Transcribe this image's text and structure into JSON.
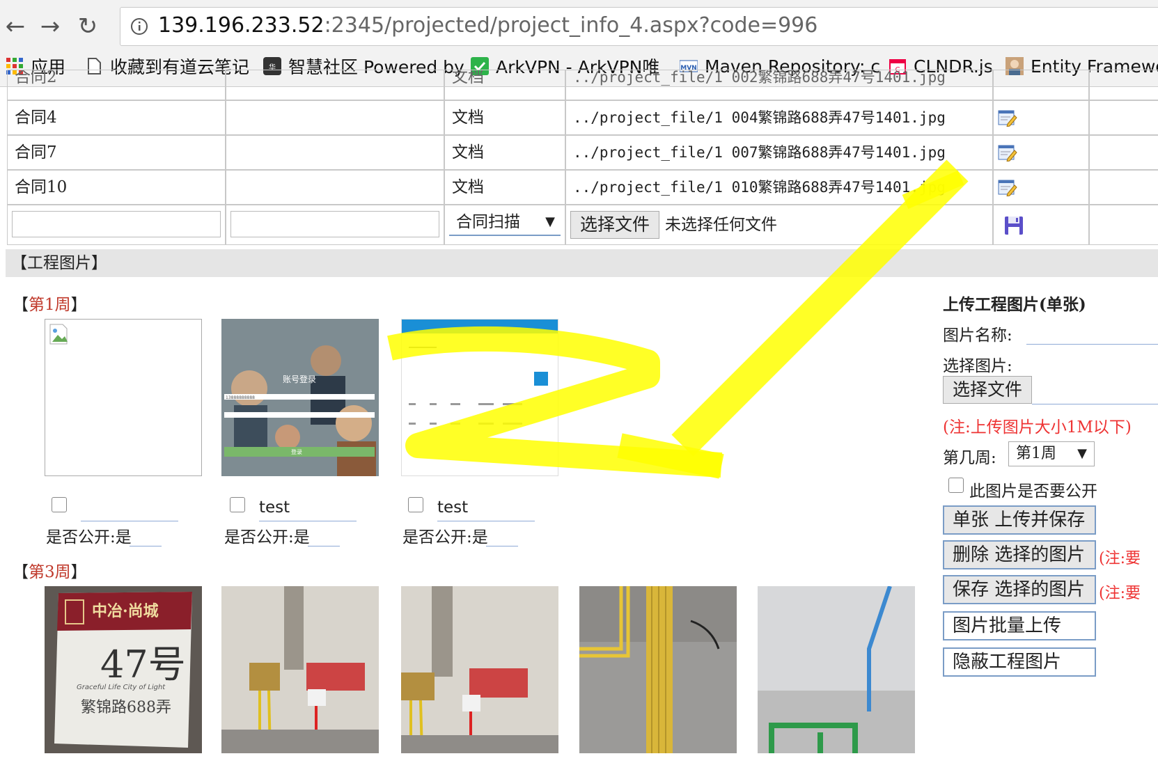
{
  "browser": {
    "url_host": "139.196.233.52",
    "url_path": ":2345/projected/project_info_4.aspx?code=996",
    "bookmarks": [
      {
        "label": "应用",
        "icon": "apps-grid-icon"
      },
      {
        "label": "收藏到有道云笔记",
        "icon": "page-icon"
      },
      {
        "label": "智慧社区 Powered by",
        "icon": "huayuan-logo-icon"
      },
      {
        "label": "ArkVPN - ArkVPN唯",
        "icon": "green-check-icon"
      },
      {
        "label": "Maven Repository: c",
        "icon": "mvn-icon"
      },
      {
        "label": "CLNDR.js",
        "icon": "calendar-icon"
      },
      {
        "label": "Entity Framewo",
        "icon": "avatar-icon"
      }
    ]
  },
  "file_table": {
    "partial_row": {
      "name": "合同2",
      "type": "文档",
      "path": "../project_file/1 002繁锦路688弄47号1401.jpg"
    },
    "rows": [
      {
        "name": "合同4",
        "note": "",
        "type": "文档",
        "path": "../project_file/1 004繁锦路688弄47号1401.jpg"
      },
      {
        "name": "合同7",
        "note": "",
        "type": "文档",
        "path": "../project_file/1 007繁锦路688弄47号1401.jpg"
      },
      {
        "name": "合同10",
        "note": "",
        "type": "文档",
        "path": "../project_file/1 010繁锦路688弄47号1401.jpg"
      }
    ],
    "new_row": {
      "type_select": "合同扫描",
      "choose_file": "选择文件",
      "no_file": "未选择任何文件"
    }
  },
  "photos_section": {
    "title": "【工程图片】",
    "week1": {
      "label_open": "【",
      "label_week": "第1周",
      "label_close": "】",
      "items": [
        {
          "name": "",
          "public": "是否公开:是"
        },
        {
          "name": "test",
          "public": "是否公开:是"
        },
        {
          "name": "test",
          "public": "是否公开:是"
        }
      ],
      "login_screenshot": {
        "title": "账号登录",
        "phone": "13888888888",
        "login_btn": "登录"
      }
    },
    "week3": {
      "label_open": "【",
      "label_week": "第3周",
      "label_close": "】",
      "sign": {
        "brand": "中冶·尚城",
        "number": "47号",
        "subtitle": "Graceful Life City of Light",
        "street": "繁锦路688弄"
      }
    }
  },
  "upload_panel": {
    "title": "上传工程图片(单张)",
    "name_label": "图片名称:",
    "select_label": "选择图片:",
    "choose_file": "选择文件",
    "note": "(注:上传图片大小1M以下)",
    "week_label": "第几周:",
    "week_value": "第1周",
    "public_label": "此图片是否要公开",
    "buttons": [
      {
        "label": "单张 上传并保存",
        "note": ""
      },
      {
        "label": "删除 选择的图片",
        "note": "(注:要"
      },
      {
        "label": "保存 选择的图片",
        "note": "(注:要"
      },
      {
        "label": "图片批量上传",
        "note": ""
      },
      {
        "label": "隐蔽工程图片",
        "note": ""
      }
    ]
  },
  "colors": {
    "annotation": "#ffff00",
    "week_label": "#c0392b",
    "note_red": "#e33333",
    "button_border": "#7a9cc6"
  }
}
